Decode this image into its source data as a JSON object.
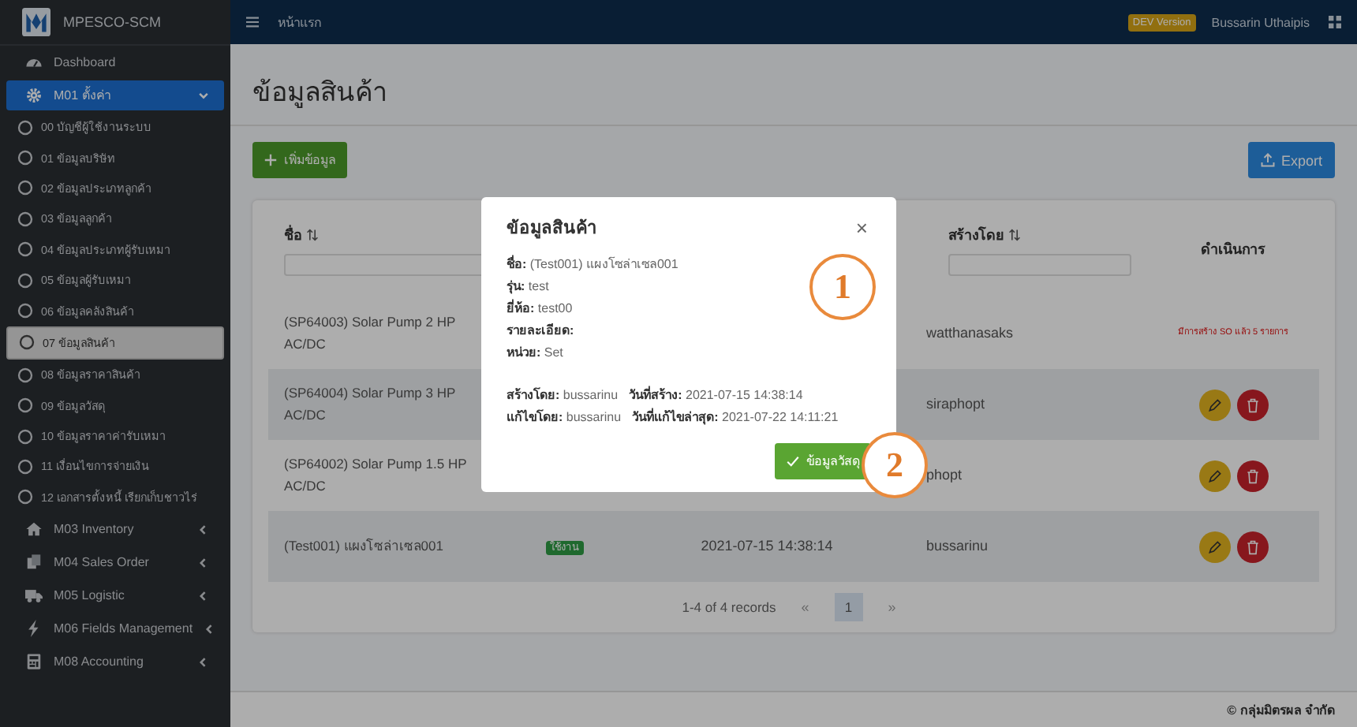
{
  "sidebar": {
    "brand": "MPESCO-SCM",
    "items": [
      {
        "kind": "link",
        "label": "Dashboard",
        "selected": false
      },
      {
        "kind": "module",
        "label": "M01 ตั้งค่า",
        "selected": true,
        "expanded": true,
        "children": [
          {
            "label": "00 บัญชีผู้ใช้งานระบบ",
            "selected": false
          },
          {
            "label": "01 ข้อมูลบริษัท",
            "selected": false
          },
          {
            "label": "02 ข้อมูลประเภทลูกค้า",
            "selected": false
          },
          {
            "label": "03 ข้อมูลลูกค้า",
            "selected": false
          },
          {
            "label": "04 ข้อมูลประเภทผู้รับเหมา",
            "selected": false
          },
          {
            "label": "05 ข้อมูลผู้รับเหมา",
            "selected": false
          },
          {
            "label": "06 ข้อมูลคลังสินค้า",
            "selected": false
          },
          {
            "label": "07 ข้อมูลสินค้า",
            "selected": true
          },
          {
            "label": "08 ข้อมูลราคาสินค้า",
            "selected": false
          },
          {
            "label": "09 ข้อมูลวัสดุ",
            "selected": false
          },
          {
            "label": "10 ข้อมูลราคาค่ารับเหมา",
            "selected": false
          },
          {
            "label": "11 เงื่อนไขการจ่ายเงิน",
            "selected": false
          },
          {
            "label": "12 เอกสารตั้งหนี้ เรียกเก็บชาวไร่",
            "selected": false
          }
        ]
      },
      {
        "kind": "module",
        "label": "M03 Inventory",
        "selected": false,
        "expanded": false
      },
      {
        "kind": "module",
        "label": "M04 Sales Order",
        "selected": false,
        "expanded": false
      },
      {
        "kind": "module",
        "label": "M05 Logistic",
        "selected": false,
        "expanded": false
      },
      {
        "kind": "module",
        "label": "M06 Fields Management",
        "selected": false,
        "expanded": false
      },
      {
        "kind": "module",
        "label": "M08 Accounting",
        "selected": false,
        "expanded": false
      }
    ]
  },
  "topbar": {
    "breadcrumb": "หน้าแรก",
    "badge": "DEV Version",
    "user": "Bussarin Uthaipis"
  },
  "page": {
    "title": "ข้อมูลสินค้า",
    "add_button": "เพิ่มข้อมูล",
    "export_button": "Export"
  },
  "table": {
    "columns": [
      {
        "label": "ชื่อ",
        "sortable": true,
        "filter": true
      },
      {
        "label": "สร้างโดย",
        "sortable": true,
        "filter": true
      },
      {
        "label": "ดำเนินการ",
        "sortable": false,
        "filter": false
      }
    ],
    "rows": [
      {
        "name": "(SP64003) Solar Pump 2 HP AC/DC",
        "created_by": "watthanasaks",
        "actions": {
          "kind": "note",
          "text": "มีการสร้าง SO แล้ว 5 รายการ"
        }
      },
      {
        "name": "(SP64004) Solar Pump 3 HP AC/DC",
        "created_by": "siraphopt",
        "actions": {
          "kind": "buttons"
        }
      },
      {
        "name": "(SP64002) Solar Pump 1.5 HP AC/DC",
        "created_by": "phopt",
        "actions": {
          "kind": "buttons"
        }
      },
      {
        "name": "(Test001) แผงโซล่าเซล001",
        "status": "ใช้งาน",
        "created_date": "2021-07-15 14:38:14",
        "created_by": "bussarinu",
        "actions": {
          "kind": "buttons"
        }
      }
    ],
    "pagination": {
      "summary": "1-4 of 4 records",
      "prev": "«",
      "pages": [
        {
          "label": "1",
          "selected": true
        }
      ],
      "next": "»"
    }
  },
  "footer": "© กลุ่มมิตรผล จำกัด",
  "modal": {
    "title": "ข้อมูลสินค้า",
    "close": "×",
    "fields": [
      {
        "label": "ชื่อ:",
        "value": "(Test001) แผงโซล่าเซล001"
      },
      {
        "label": "รุ่น:",
        "value": "test"
      },
      {
        "label": "ยี่ห้อ:",
        "value": "test00"
      },
      {
        "label": "รายละเอียด:"
      },
      {
        "label": "หน่วย:",
        "value": "Set"
      }
    ],
    "meta": [
      [
        {
          "label": "สร้างโดย:",
          "value": "bussarinu"
        },
        {
          "label": "วันที่สร้าง:",
          "value": "2021-07-15 14:38:14"
        }
      ],
      [
        {
          "label": "แก้ไขโดย:",
          "value": "bussarinu"
        },
        {
          "label": "วันที่แก้ไขล่าสุด:",
          "value": "2021-07-22 14:11:21"
        }
      ]
    ],
    "button": "ข้อมูลวัสดุ"
  },
  "annotations": [
    "1",
    "2"
  ]
}
